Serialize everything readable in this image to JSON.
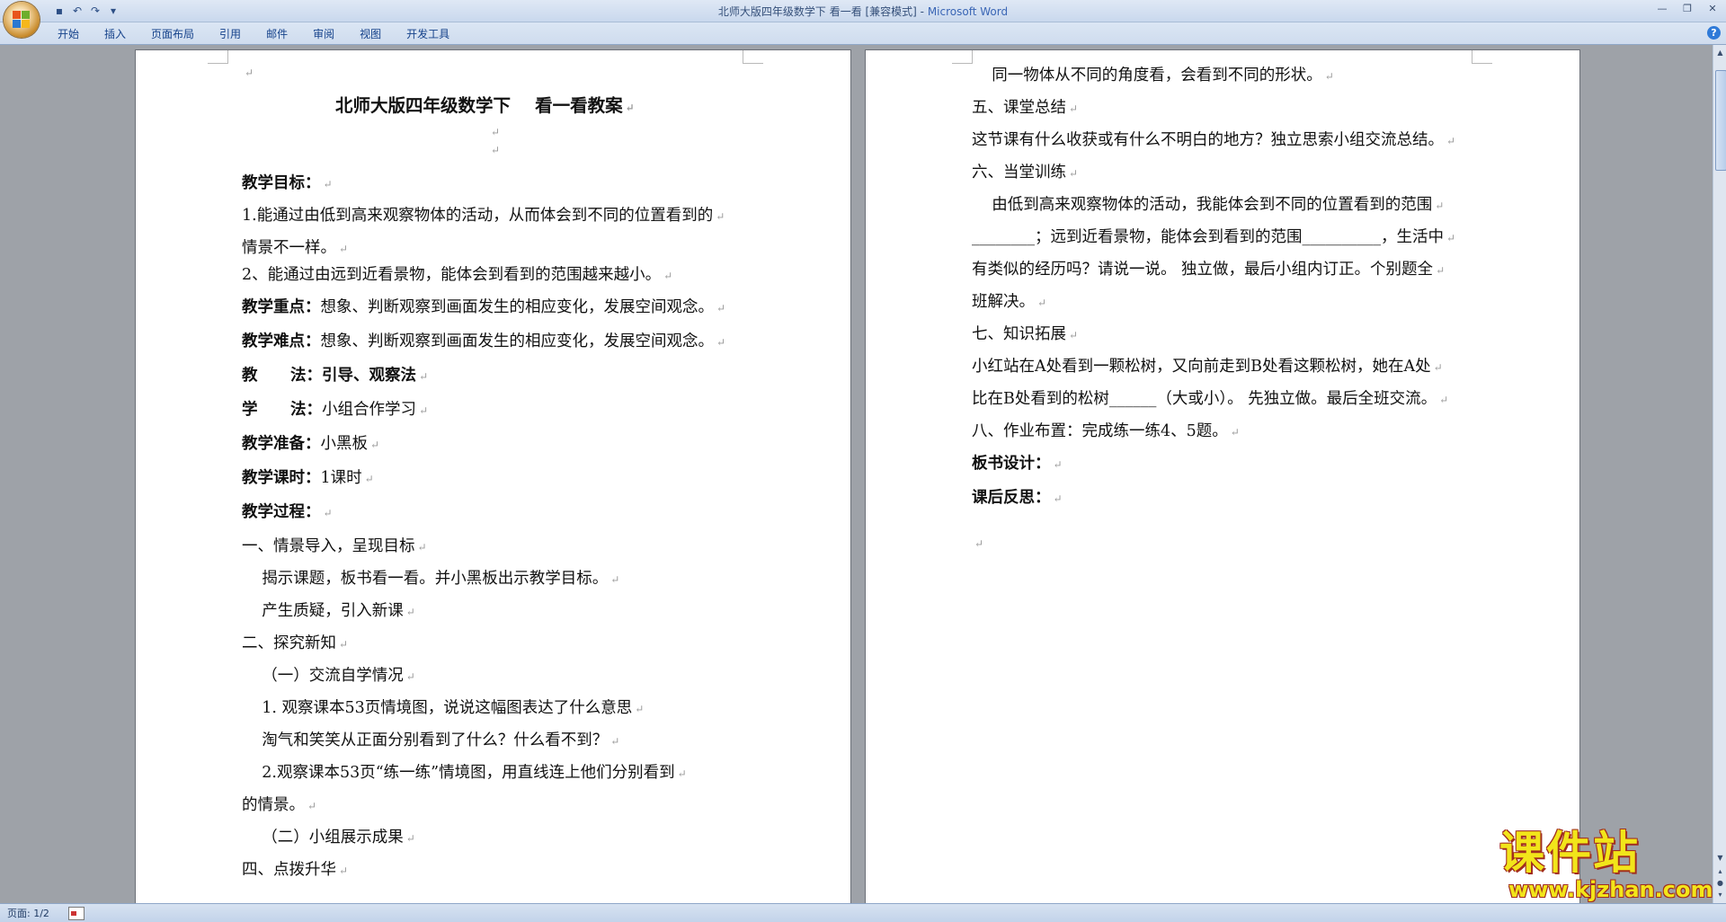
{
  "window": {
    "title": "北师大版四年级数学下 看一看 [兼容模式] - ",
    "app_name": "Microsoft Word"
  },
  "quick_access": [
    {
      "icon": "save-icon",
      "glyph": "▪"
    },
    {
      "icon": "undo-icon",
      "glyph": "↶"
    },
    {
      "icon": "redo-icon",
      "glyph": "↷"
    },
    {
      "icon": "customize-qat-icon",
      "glyph": "▾"
    }
  ],
  "window_controls": {
    "minimize": "—",
    "restore": "❐",
    "close": "✕"
  },
  "ribbon": {
    "tabs": [
      "开始",
      "插入",
      "页面布局",
      "引用",
      "邮件",
      "审阅",
      "视图",
      "开发工具"
    ],
    "help": "?"
  },
  "page1": {
    "title": "北师大版四年级数学下    看一看教案",
    "lines": [
      {
        "bold": "教学目标：",
        "text": ""
      },
      {
        "bold": "",
        "text": "1.能通过由低到高来观察物体的活动，从而体会到不同的位置看到的"
      },
      {
        "bold": "",
        "text": "情景不一样。"
      },
      {
        "bold": "",
        "text": "2、能通过由远到近看景物，能体会到看到的范围越来越小。"
      },
      {
        "bold": "教学重点：",
        "text": "想象、判断观察到画面发生的相应变化，发展空间观念。"
      },
      {
        "bold": "教学难点：",
        "text": "想象、判断观察到画面发生的相应变化，发展空间观念。"
      },
      {
        "bold": "教      法：引导、观察法",
        "text": ""
      },
      {
        "bold": "学      法：",
        "text": "小组合作学习"
      },
      {
        "bold": "教学准备：",
        "text": "小黑板"
      },
      {
        "bold": "教学课时：",
        "text": "1课时"
      },
      {
        "bold": "教学过程：",
        "text": ""
      },
      {
        "bold": "",
        "text": "一、情景导入，呈现目标"
      },
      {
        "bold": "",
        "text": "    揭示课题，板书看一看。并小黑板出示教学目标。"
      },
      {
        "bold": "",
        "text": "    产生质疑，引入新课"
      },
      {
        "bold": "",
        "text": "二、探究新知"
      },
      {
        "bold": "",
        "text": "    （一）交流自学情况"
      },
      {
        "bold": "",
        "text": "    1. 观察课本53页情境图，说说这幅图表达了什么意思"
      },
      {
        "bold": "",
        "text": "    淘气和笑笑从正面分别看到了什么？什么看不到？"
      },
      {
        "bold": "",
        "text": "    2.观察课本53页“练一练”情境图，用直线连上他们分别看到"
      },
      {
        "bold": "",
        "text": "的情景。"
      },
      {
        "bold": "",
        "text": "    （二）小组展示成果"
      },
      {
        "bold": "",
        "text": "四、点拨升华"
      }
    ]
  },
  "page2": {
    "lines": [
      {
        "bold": "",
        "text": "    同一物体从不同的角度看，会看到不同的形状。"
      },
      {
        "bold": "",
        "text": "五、课堂总结"
      },
      {
        "bold": "",
        "text": "这节课有什么收获或有什么不明白的地方？独立思索小组交流总结。"
      },
      {
        "bold": "",
        "text": "六、当堂训练"
      },
      {
        "bold": "",
        "text": "    由低到高来观察物体的活动，我能体会到不同的位置看到的范围"
      },
      {
        "bold": "",
        "text": "________；远到近看景物，能体会到看到的范围__________，生活中"
      },
      {
        "bold": "",
        "text": "有类似的经历吗？请说一说。 独立做，最后小组内订正。个别题全"
      },
      {
        "bold": "",
        "text": "班解决。"
      },
      {
        "bold": "",
        "text": "七、知识拓展"
      },
      {
        "bold": "",
        "text": "小红站在A处看到一颗松树，又向前走到B处看这颗松树，她在A处"
      },
      {
        "bold": "",
        "text": "比在B处看到的松树______（大或小）。 先独立做。最后全班交流。"
      },
      {
        "bold": "",
        "text": "八、作业布置：完成练一练4、5题。"
      },
      {
        "bold": "板书设计：",
        "text": ""
      },
      {
        "bold": "课后反思：",
        "text": ""
      }
    ]
  },
  "paragraph_mark": "↵",
  "status": {
    "page_indicator": "页面: 1/2"
  },
  "watermark": {
    "logo": "课件站",
    "url": "www.kjzhan.com"
  },
  "colors": {
    "app_name": "#3a66b5",
    "tab_text": "#15428b",
    "watermark_fill": "#f2e51a",
    "watermark_outline": "#a12d1e"
  }
}
